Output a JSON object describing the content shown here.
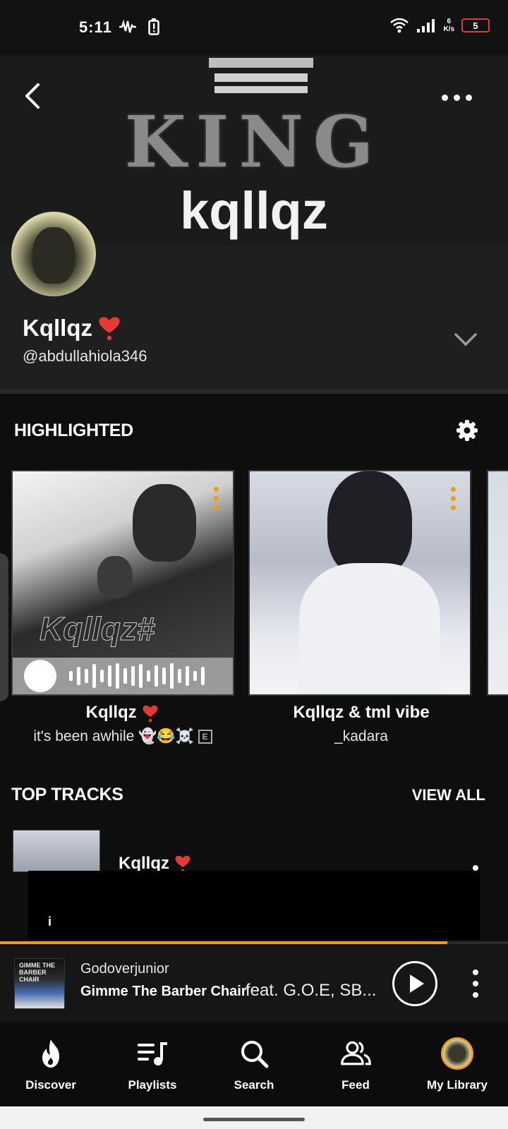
{
  "status_bar": {
    "time": "5:11",
    "net_speed_top": "6",
    "net_speed_bottom": "K/s",
    "battery": "5"
  },
  "banner": {
    "title_line1": "KING",
    "title_line2": "kqllqz"
  },
  "profile": {
    "name": "Kqllqz",
    "handle": "@abdullahiola346"
  },
  "highlighted": {
    "title": "HIGHLIGHTED",
    "cards": [
      {
        "title": "Kqllqz",
        "subtitle": "it's been awhile 👻😂☠️",
        "explicit": "E",
        "art_text": "Kqllqz#"
      },
      {
        "title": "Kqllqz & tml vibe",
        "subtitle": "_kadara"
      }
    ]
  },
  "top_tracks": {
    "title": "TOP TRACKS",
    "view_all": "VIEW ALL",
    "first_track": "Kqllqz"
  },
  "ad": {
    "label": "i"
  },
  "player": {
    "progress": 0.88,
    "artist": "Godoverjunior",
    "track": "Gimme The Barber Chair",
    "feat": "feat. G.O.E, SB...",
    "art_text": "GIMME THE BARBER CHAIR"
  },
  "nav": [
    {
      "label": "Discover",
      "icon": "flame-icon"
    },
    {
      "label": "Playlists",
      "icon": "playlist-icon"
    },
    {
      "label": "Search",
      "icon": "search-icon"
    },
    {
      "label": "Feed",
      "icon": "people-icon"
    },
    {
      "label": "My Library",
      "icon": "avatar-icon"
    }
  ],
  "colors": {
    "accent": "#f39c12",
    "heart": "#e53935",
    "background": "#0e0e0e"
  }
}
